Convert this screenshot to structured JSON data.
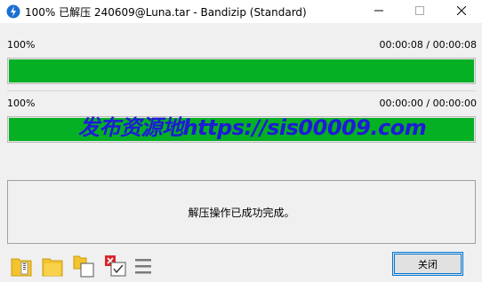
{
  "window": {
    "title": "100% 已解压 240609@Luna.tar - Bandizip (Standard)",
    "app_icon": "bandizip-icon",
    "controls": [
      "minimize-icon",
      "maximize-icon",
      "close-icon"
    ]
  },
  "progress": [
    {
      "percent_label": "100%",
      "time": "00:00:08 / 00:00:08",
      "fill": 1.0
    },
    {
      "percent_label": "100%",
      "time": "00:00:00 / 00:00:00",
      "fill": 1.0
    }
  ],
  "watermark": "发布资源地https://sis00009.com",
  "message": "解压操作已成功完成。",
  "toolbar_icons": [
    "open-folder-icon",
    "open-extract-folder-icon",
    "copy-icon",
    "delete-archive-icon",
    "menu-icon"
  ],
  "buttons": {
    "close_label": "关闭"
  },
  "colors": {
    "progress_fill": "#06b025",
    "accent": "#0078d7",
    "watermark": "#1f1bd6"
  }
}
